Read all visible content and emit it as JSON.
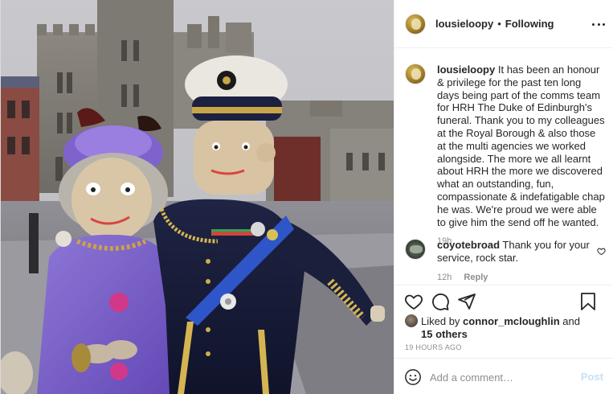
{
  "post": {
    "author": "lousieloopy",
    "separator": "•",
    "follow_status": "Following",
    "caption": "It has been an honour & privilege for the past ten long days being part of the comms team for HRH The Duke of Edinburgh's funeral. Thank you to my colleagues at the Royal Borough & also those at the multi agencies we worked alongside. The more we all learnt about HRH the more we discovered what an outstanding, fun, compassionate & indefatigable chap he was. We're proud we were able to give him the send off he wanted.",
    "caption_age": "19h"
  },
  "comments": [
    {
      "user": "coyotebroad",
      "text": "Thank you for your service, rock star.",
      "age": "12h",
      "reply_label": "Reply"
    }
  ],
  "likes": {
    "prefix": "Liked by",
    "user": "connor_mcloughlin",
    "conjunction": "and",
    "others": "15 others"
  },
  "timestamp": "19 HOURS AGO",
  "composer": {
    "placeholder": "Add a comment…",
    "post_label": "Post"
  },
  "icons": {
    "like": "heart-icon",
    "comment": "speech-bubble-icon",
    "share": "paper-plane-icon",
    "save": "bookmark-icon",
    "more": "ellipsis-icon",
    "emoji": "smiley-icon"
  },
  "colors": {
    "text": "#262626",
    "muted": "#8e8e8e",
    "border": "#efefef",
    "post_disabled": "#c7e0f4"
  }
}
